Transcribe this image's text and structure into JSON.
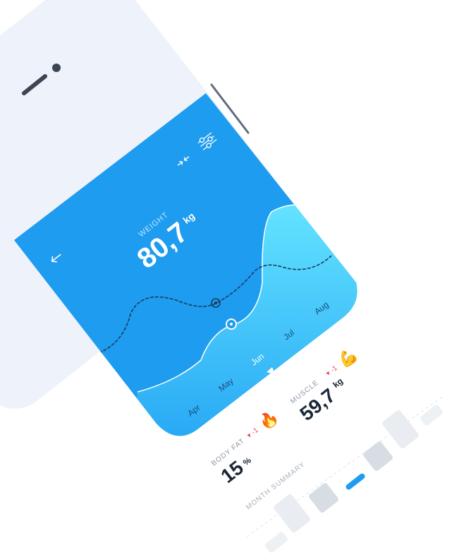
{
  "app": {
    "accent": "#1e9cf0",
    "accent_light": "#5fe0ff",
    "bezel": "#eef2fb"
  },
  "header": {
    "weight_label": "WEIGHT",
    "weight_value": "80,7",
    "weight_unit": "kg",
    "back_icon": "arrow-left-icon",
    "collapse_icon": "collapse-arrows-icon",
    "filter_icon": "sliders-icon"
  },
  "chart": {
    "months": [
      "Apr",
      "May",
      "Jun",
      "Jul",
      "Aug"
    ],
    "selected_month": "Jun"
  },
  "stats": {
    "muscle": {
      "label": "MUSCLE",
      "value": "59,7",
      "unit": "kg",
      "delta": "-1",
      "emoji": "💪"
    },
    "body_fat": {
      "label": "BODY FAT",
      "value": "15",
      "unit": "%",
      "delta": "-1",
      "emoji": "🔥"
    }
  },
  "summary": {
    "title": "MONTH SUMMARY"
  }
}
